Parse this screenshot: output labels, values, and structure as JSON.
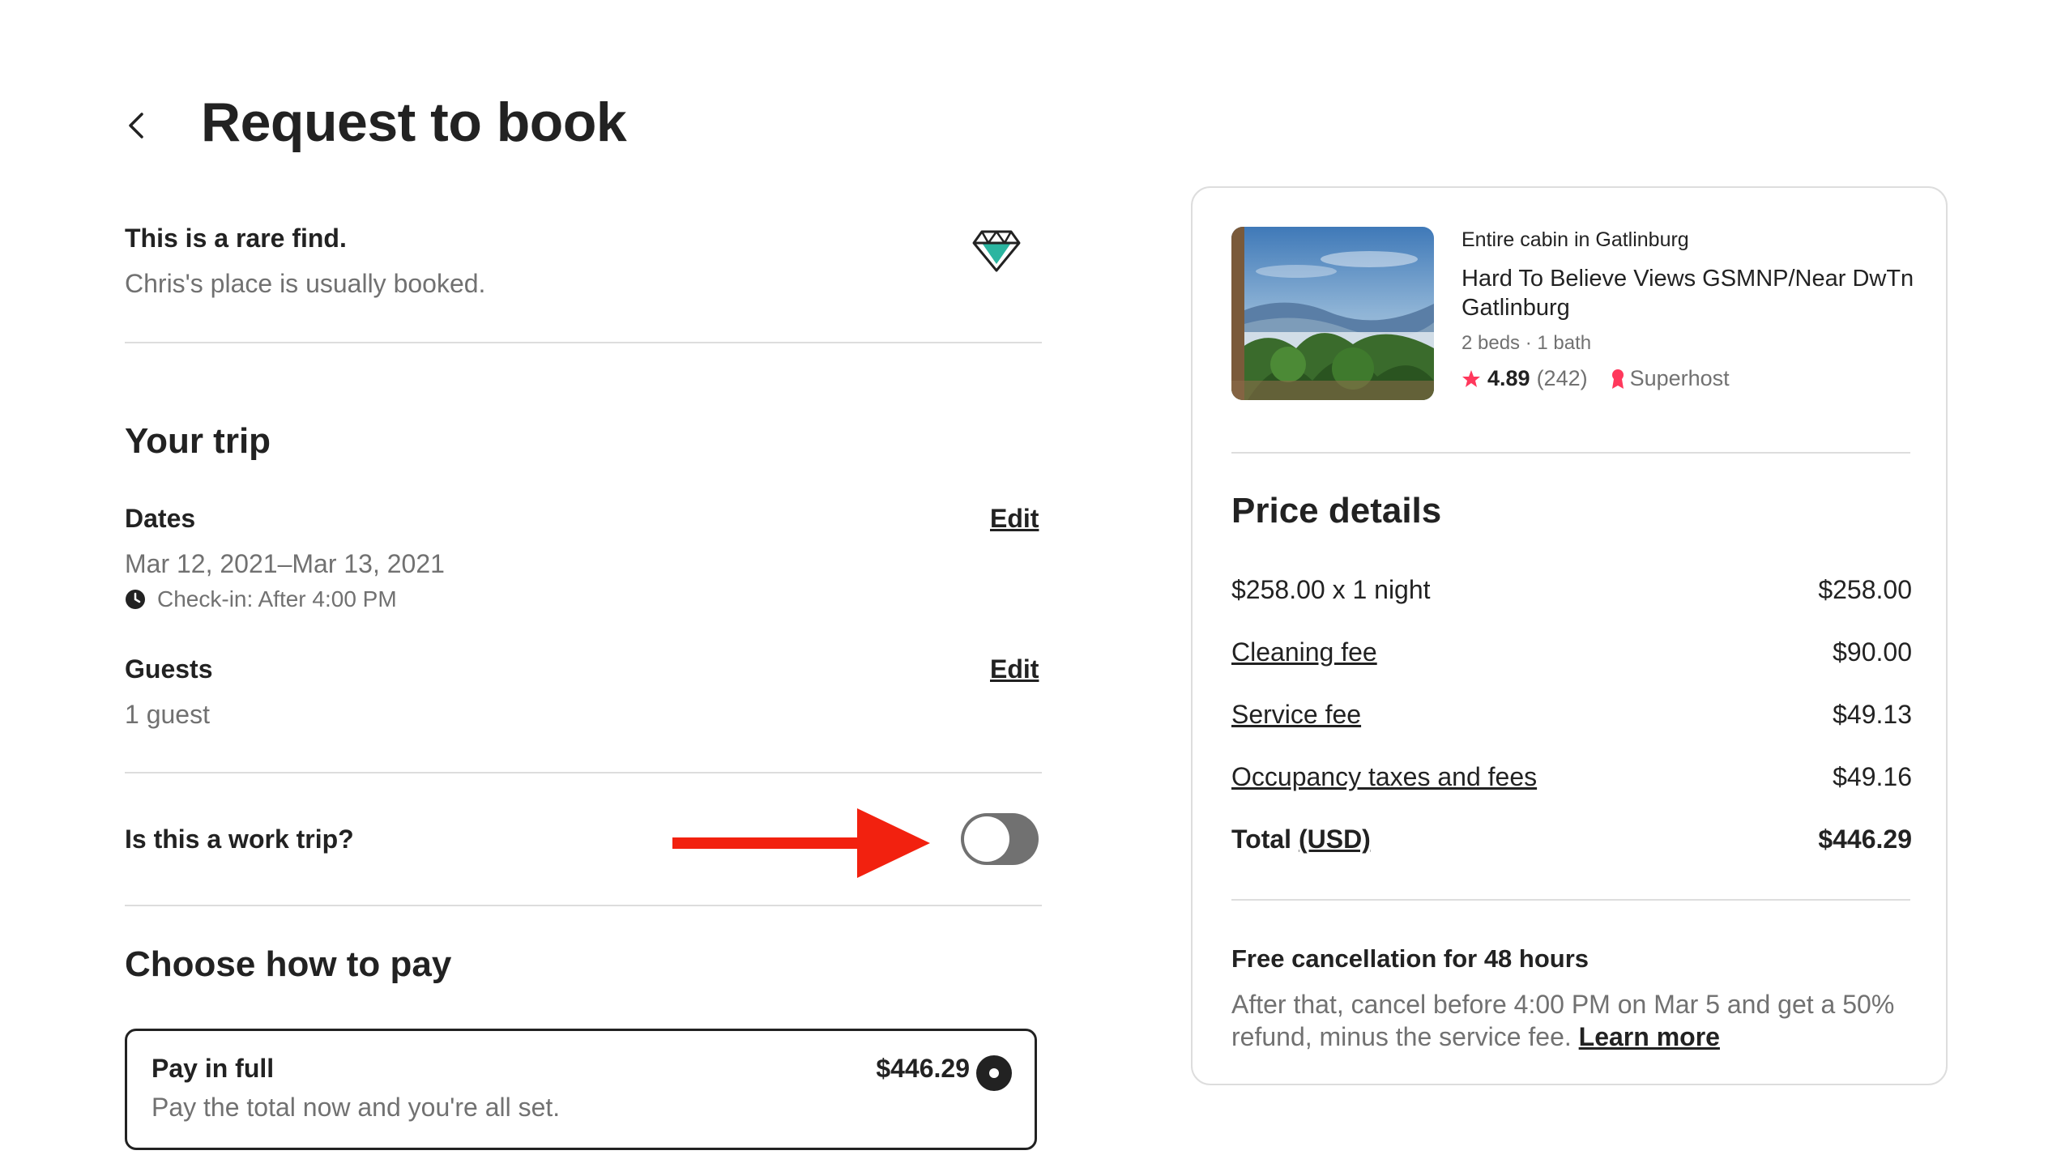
{
  "header": {
    "title": "Request to book"
  },
  "rare_find": {
    "title": "This is a rare find.",
    "subtitle": "Chris's place is usually booked."
  },
  "trip": {
    "title": "Your trip",
    "dates": {
      "label": "Dates",
      "value": "Mar 12, 2021–Mar 13, 2021",
      "checkin": "Check-in: After 4:00 PM",
      "edit_label": "Edit"
    },
    "guests": {
      "label": "Guests",
      "value": "1 guest",
      "edit_label": "Edit"
    }
  },
  "work_trip": {
    "label": "Is this a work trip?",
    "enabled": false
  },
  "payment": {
    "title": "Choose how to pay",
    "options": [
      {
        "title": "Pay in full",
        "subtitle": "Pay the total now and you're all set.",
        "price": "$446.29",
        "selected": true
      }
    ]
  },
  "listing": {
    "type": "Entire cabin in Gatlinburg",
    "title": "Hard To Believe Views GSMNP/Near DwTn Gatlinburg",
    "meta": "2 beds · 1 bath",
    "rating": "4.89",
    "reviews": "(242)",
    "badge": "Superhost"
  },
  "price_details": {
    "title": "Price details",
    "rows": [
      {
        "label": "$258.00 x 1 night",
        "amount": "$258.00"
      },
      {
        "label": "Cleaning fee",
        "amount": "$90.00"
      },
      {
        "label": "Service fee",
        "amount": "$49.13"
      },
      {
        "label": "Occupancy taxes and fees",
        "amount": "$49.16"
      }
    ],
    "total": {
      "label": "Total",
      "currency": "(USD)",
      "amount": "$446.29"
    }
  },
  "cancellation": {
    "title": "Free cancellation for 48 hours",
    "body": "After that, cancel before 4:00 PM on Mar 5 and get a 50% refund, minus the service fee.",
    "link": "Learn more"
  },
  "colors": {
    "text": "#222222",
    "muted": "#717171",
    "divider": "#dddddd",
    "accent": "#FF385C",
    "arrow": "#F2210F",
    "gem": "#2BB5A0"
  }
}
